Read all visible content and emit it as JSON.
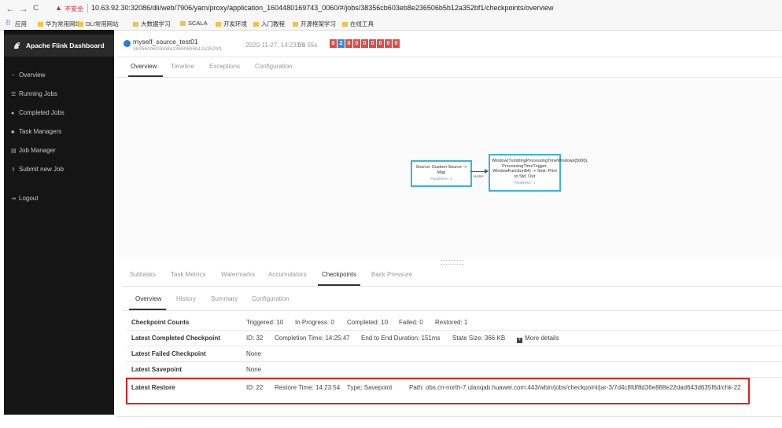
{
  "browser": {
    "nav": {
      "back": "←",
      "forward": "→",
      "reload": "C"
    },
    "security_warning": "不安全",
    "url": "10.63.92.30:32086/dli/web/7906/yarn/proxy/application_1604480169743_0060/#/jobs/38356cb603eb8e236506b5b12a352bf1/checkpoints/overview",
    "bookmarks": [
      {
        "label": "应用",
        "kind": "apps"
      },
      {
        "label": "华为常用网站",
        "kind": "folder"
      },
      {
        "label": "DLI常用网站",
        "kind": "folder"
      },
      {
        "label": "大数据学习",
        "kind": "folder"
      },
      {
        "label": "SCALA",
        "kind": "folder"
      },
      {
        "label": "开发环境",
        "kind": "folder"
      },
      {
        "label": "入门教程",
        "kind": "folder"
      },
      {
        "label": "开源框架学习",
        "kind": "folder"
      },
      {
        "label": "在线工具",
        "kind": "folder"
      }
    ]
  },
  "sidebar": {
    "title": "Apache Flink Dashboard",
    "items": [
      {
        "label": "Overview",
        "icon": "dashboard-icon",
        "glyph": "◔"
      },
      {
        "label": "Running Jobs",
        "icon": "list-icon",
        "glyph": "☰"
      },
      {
        "label": "Completed Jobs",
        "icon": "check-circle-icon",
        "glyph": "●"
      },
      {
        "label": "Task Managers",
        "icon": "sitemap-icon",
        "glyph": "♣"
      },
      {
        "label": "Job Manager",
        "icon": "server-icon",
        "glyph": "▤"
      },
      {
        "label": "Submit new Job",
        "icon": "upload-icon",
        "glyph": "⇪"
      },
      {
        "label": "Logout",
        "icon": "logout-icon",
        "glyph": "⇥"
      }
    ]
  },
  "job": {
    "name": "myself_source_test01",
    "id": "38356cb603eb8e236506b5b12a352bf1",
    "start_time": "2020-11-27, 14:23:53",
    "duration": "1m 55s",
    "status_counts": [
      "0",
      "2",
      "0",
      "0",
      "0",
      "0",
      "0",
      "0",
      "0"
    ],
    "status_colors": [
      "#e34b4b",
      "#3c8ad8",
      "#e34b4b",
      "#e34b4b",
      "#e34b4b",
      "#e34b4b",
      "#e34b4b",
      "#e34b4b",
      "#e34b4b"
    ]
  },
  "tabs": [
    "Overview",
    "Timeline",
    "Exceptions",
    "Configuration"
  ],
  "graph": {
    "source_node": {
      "label": "Source: Custom Source -> Map",
      "parallelism": "Parallelism: 1"
    },
    "window_node": {
      "label": "Window(TumblingProcessingTimeWindows(5000), ProcessingTimeTrigger, WindowFunction$4) -> Sink: Print to Std. Out",
      "parallelism": "Parallelism: 1"
    },
    "edge_label": "HASH"
  },
  "subtabs": [
    "Subtasks",
    "Task Metrics",
    "Watermarks",
    "Accumulators",
    "Checkpoints",
    "Back Pressure"
  ],
  "checkpoint_tabs": [
    "Overview",
    "History",
    "Summary",
    "Configuration"
  ],
  "checkpoints": {
    "counts": {
      "label": "Checkpoint Counts",
      "triggered": "Triggered: 10",
      "in_progress": "In Progress: 0",
      "completed": "Completed: 10",
      "failed": "Failed: 0",
      "restored": "Restored: 1"
    },
    "latest_completed": {
      "label": "Latest Completed Checkpoint",
      "id": "ID: 32",
      "completion_time": "Completion Time: 14:25:47",
      "duration": "End to End Duration: 151ms",
      "state_size": "State Size: 366 KB",
      "more": "More details"
    },
    "latest_failed": {
      "label": "Latest Failed Checkpoint",
      "value": "None"
    },
    "latest_savepoint": {
      "label": "Latest Savepoint",
      "value": "None"
    },
    "latest_restore": {
      "label": "Latest Restore",
      "id": "ID: 22",
      "restore_time": "Restore Time: 14:23:54",
      "type": "Type: Savepoint",
      "path": "Path: obs.cn-north-7.ulanqab.huawei.com:443/wbin/jobs/checkpoint/jar-3/7d4c8fdf8d36e888e22dad643d635f6d/chk-22"
    }
  },
  "colors": {
    "sidebar_bg": "#151515",
    "accent": "#2c7ad6",
    "node_border": "#3cb4d9",
    "highlight": "#e02020"
  }
}
